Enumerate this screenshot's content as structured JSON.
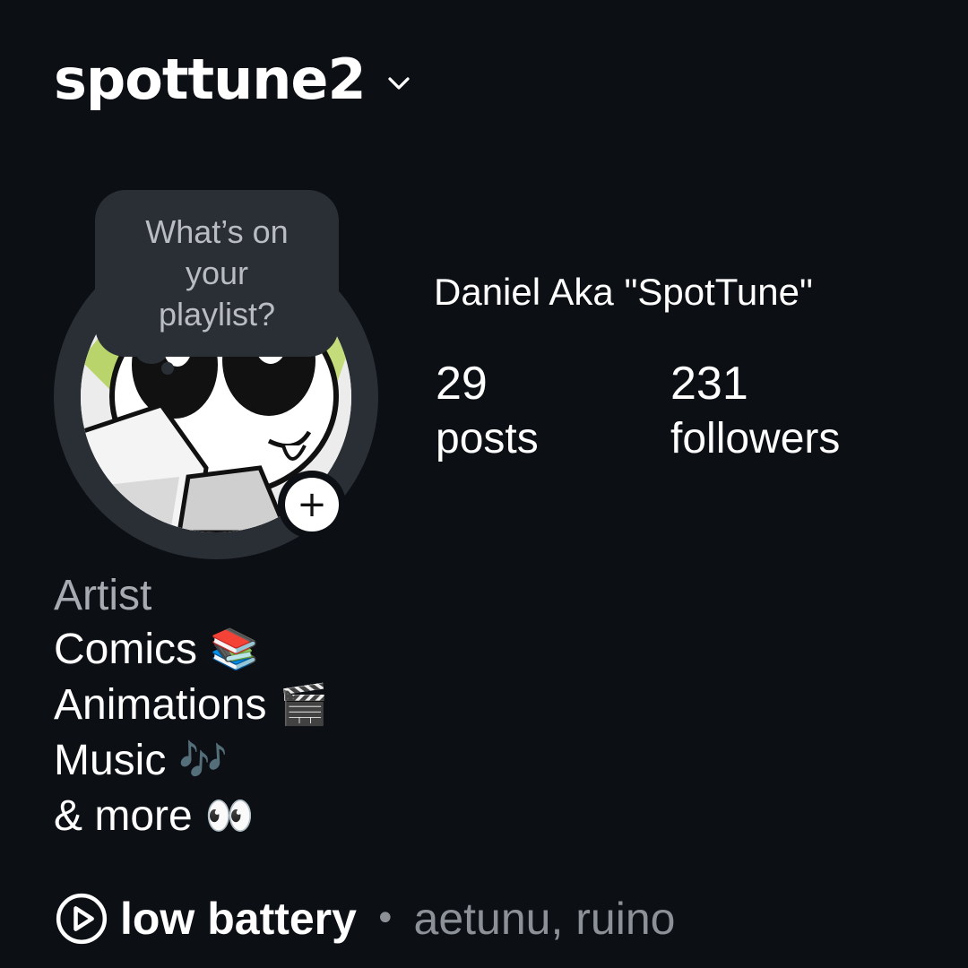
{
  "header": {
    "username": "spottune2"
  },
  "note": {
    "text": "What’s on your playlist?"
  },
  "profile": {
    "display_name": "Daniel Aka \"SpotTune\"",
    "posts_count": "29",
    "posts_label": "posts",
    "followers_count": "231",
    "followers_label": "followers"
  },
  "bio": {
    "category": "Artist",
    "lines": [
      {
        "text": "Comics",
        "emoji": "📚"
      },
      {
        "text": "Animations",
        "emoji": "🎬"
      },
      {
        "text": "Music",
        "emoji": "🎶"
      },
      {
        "text": "& more",
        "emoji": "👀"
      }
    ]
  },
  "music": {
    "song": "low battery",
    "separator": "•",
    "artists": "aetunu, ruino"
  },
  "colors": {
    "background": "#0c0f14",
    "bubble": "#2a2f36",
    "muted_text": "#8c9097"
  },
  "icons": {
    "chevron": "chevron-down-icon",
    "add": "plus-icon",
    "play": "play-circle-icon"
  }
}
